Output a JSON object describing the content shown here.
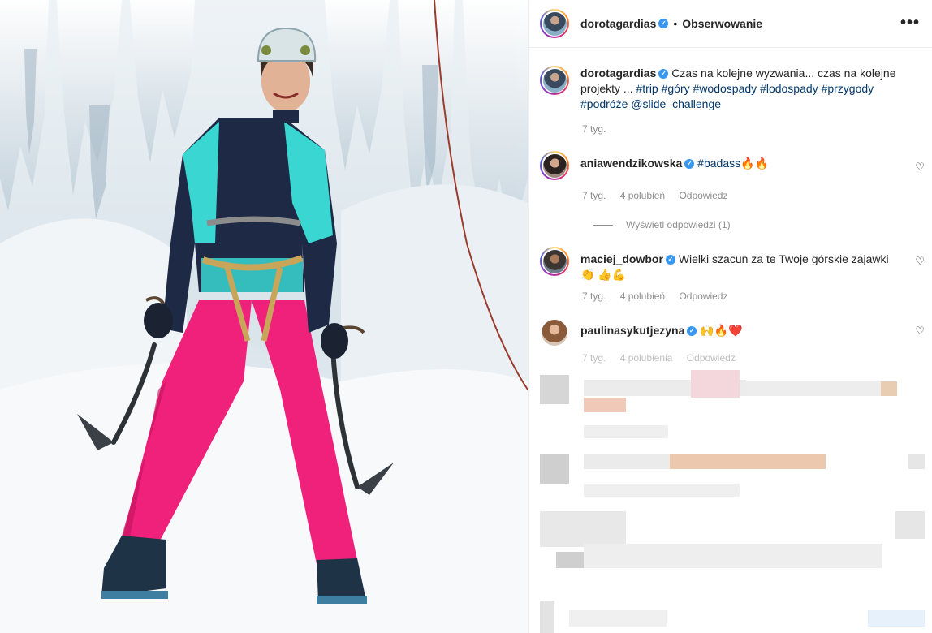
{
  "post": {
    "username": "dorotagardias",
    "follow_label": "Obserwowanie",
    "more_label": "•••",
    "caption_plain_1": "Czas na kolejne wyzwania... czas na kolejne projekty ...",
    "hashtags": [
      "#trip",
      "#góry",
      "#wodospady",
      "#lodospady",
      "#przygody",
      "#podróże"
    ],
    "mention": "@slide_challenge",
    "time": "7 tyg."
  },
  "comments": [
    {
      "username": "aniawendzikowska",
      "text_tag": "#badass",
      "emoji": "🔥🔥",
      "time": "7 tyg.",
      "likes": "4 polubień",
      "reply_label": "Odpowiedz",
      "view_replies": "Wyświetl odpowiedzi (1)"
    },
    {
      "username": "maciej_dowbor",
      "text": "Wielki szacun za te Twoje górskie zajawki 👏",
      "emoji2": "👍💪",
      "time": "7 tyg.",
      "likes": "4 polubień",
      "reply_label": "Odpowiedz"
    },
    {
      "username": "paulinasykutjezyna",
      "emoji": "🙌🔥❤️",
      "time": "7 tyg.",
      "likes": "4 polubienia",
      "reply_label": "Odpowiedz"
    }
  ],
  "icons": {
    "more": "more-horizontal-icon",
    "heart": "heart-outline-icon",
    "verified": "verified-badge-icon"
  },
  "colors": {
    "verified": "#3897f0",
    "hashtag": "#00376b",
    "muted": "#8e8e8e",
    "pants": "#f0217a",
    "jacket_teal": "#3ad6d2",
    "jacket_navy": "#1e2a45"
  }
}
